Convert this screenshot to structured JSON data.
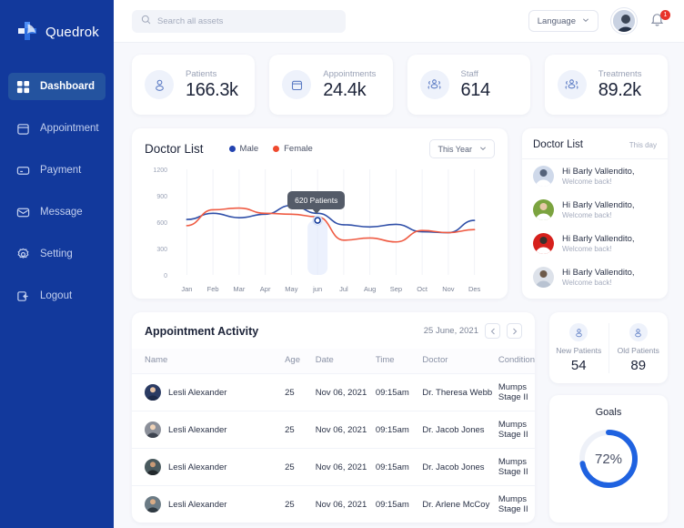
{
  "brand": {
    "name": "Quedrok",
    "logo_icon": "medical-cross-logo"
  },
  "sidebar": {
    "items": [
      {
        "label": "Dashboard",
        "icon": "grid-icon",
        "active": true
      },
      {
        "label": "Appointment",
        "icon": "calendar-icon",
        "active": false
      },
      {
        "label": "Payment",
        "icon": "card-icon",
        "active": false
      },
      {
        "label": "Message",
        "icon": "envelope-icon",
        "active": false
      },
      {
        "label": "Setting",
        "icon": "gear-icon",
        "active": false
      },
      {
        "label": "Logout",
        "icon": "logout-icon",
        "active": false
      }
    ]
  },
  "topbar": {
    "search": {
      "placeholder": "Search all assets",
      "value": "",
      "icon": "search-icon"
    },
    "language": {
      "label": "Language",
      "icon": "chevron-down-icon"
    },
    "avatar_icon": "user-avatar",
    "bell": {
      "icon": "bell-icon",
      "badge": "1"
    }
  },
  "stats": [
    {
      "label": "Patients",
      "value": "166.3k",
      "icon": "patient-icon"
    },
    {
      "label": "Appointments",
      "value": "24.4k",
      "icon": "calendar-icon"
    },
    {
      "label": "Staff",
      "value": "614",
      "icon": "staff-icon"
    },
    {
      "label": "Treatments",
      "value": "89.2k",
      "icon": "treatment-icon"
    }
  ],
  "chart_card": {
    "title": "Doctor List",
    "range_label": "This Year",
    "range_icon": "chevron-down-icon",
    "tooltip": "620 Patients"
  },
  "chart_data": {
    "type": "line",
    "title": "Doctor List",
    "xlabel": "",
    "ylabel": "",
    "ylim": [
      0,
      1200
    ],
    "yticks": [
      "0",
      "300",
      "600",
      "900",
      "1200"
    ],
    "grid": true,
    "legend_position": "top",
    "categories": [
      "Jan",
      "Feb",
      "Mar",
      "Apr",
      "May",
      "jun",
      "Jul",
      "Aug",
      "Sep",
      "Oct",
      "Nov",
      "Des"
    ],
    "highlight": {
      "category": "jun",
      "value": 620,
      "label": "620 Patients"
    },
    "series": [
      {
        "name": "Male",
        "color": "#2f4fa8",
        "values": [
          630,
          700,
          650,
          690,
          790,
          700,
          570,
          545,
          575,
          490,
          480,
          620
        ]
      },
      {
        "name": "Female",
        "color": "#ef5b43",
        "values": [
          560,
          740,
          760,
          700,
          690,
          660,
          395,
          420,
          375,
          505,
          480,
          515
        ]
      }
    ]
  },
  "doctor_list": {
    "title": "Doctor List",
    "subtitle": "This day",
    "items": [
      {
        "name": "Hi Barly Vallendito,",
        "sub": "Welcome back!",
        "avatar_color": "#cfd9ea"
      },
      {
        "name": "Hi Barly Vallendito,",
        "sub": "Welcome back!",
        "avatar_color": "#7ba33f"
      },
      {
        "name": "Hi Barly Vallendito,",
        "sub": "Welcome back!",
        "avatar_color": "#d6201c"
      },
      {
        "name": "Hi Barly Vallendito,",
        "sub": "Welcome back!",
        "avatar_color": "#d9dde6"
      }
    ]
  },
  "appointment_activity": {
    "title": "Appointment Activity",
    "date": "25 June, 2021",
    "prev_icon": "chevron-left-icon",
    "next_icon": "chevron-right-icon",
    "columns": [
      "Name",
      "Age",
      "Date",
      "Time",
      "Doctor",
      "Condition"
    ],
    "rows": [
      {
        "name": "Lesli Alexander",
        "age": "25",
        "date": "Nov 06, 2021",
        "time": "09:15am",
        "doctor": "Dr. Theresa Webb",
        "condition": "Mumps Stage II",
        "avatar_color": "#2b3b63"
      },
      {
        "name": "Lesli Alexander",
        "age": "25",
        "date": "Nov 06, 2021",
        "time": "09:15am",
        "doctor": "Dr. Jacob Jones",
        "condition": "Mumps Stage II",
        "avatar_color": "#8b8f99"
      },
      {
        "name": "Lesli Alexander",
        "age": "25",
        "date": "Nov 06, 2021",
        "time": "09:15am",
        "doctor": "Dr. Jacob Jones",
        "condition": "Mumps Stage II",
        "avatar_color": "#4a5a5e"
      },
      {
        "name": "Lesli Alexander",
        "age": "25",
        "date": "Nov 06, 2021",
        "time": "09:15am",
        "doctor": "Dr. Arlene McCoy",
        "condition": "Mumps Stage II",
        "avatar_color": "#6b7b85"
      }
    ]
  },
  "patients_panel": {
    "new": {
      "label": "New Patients",
      "value": "54",
      "icon": "patient-icon"
    },
    "old": {
      "label": "Old Patients",
      "value": "89",
      "icon": "patient-icon"
    }
  },
  "goals": {
    "title": "Goals",
    "percent_label": "72%",
    "percent": 72,
    "arc_color": "#1f62e0",
    "track_color": "#eef1f8"
  },
  "colors": {
    "sidebar": "#12399c",
    "sidebar_active": "#24539f",
    "male": "#2f4fa8",
    "female": "#ef5b43",
    "accent": "#1f62e0",
    "badge": "#e8332a"
  }
}
